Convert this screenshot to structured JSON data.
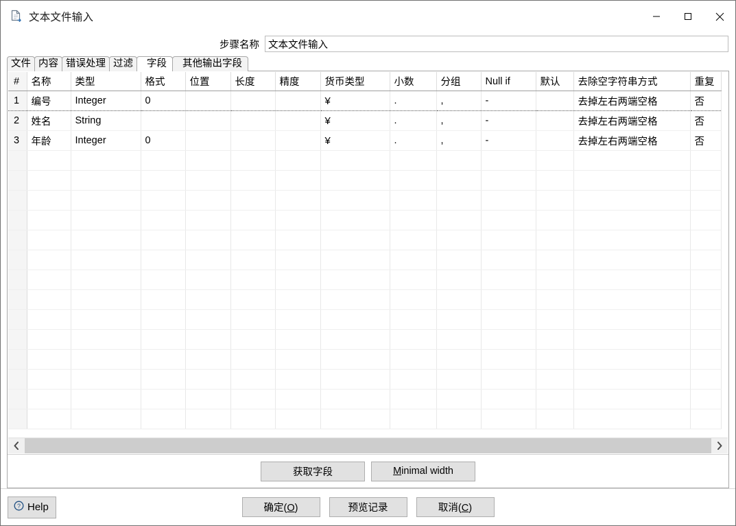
{
  "window": {
    "title": "文本文件输入",
    "icon": "file-input-icon",
    "controls": {
      "minimize": "—",
      "maximize": "□",
      "close": "✕"
    }
  },
  "step": {
    "label": "步骤名称",
    "value": "文本文件输入",
    "placeholder": ""
  },
  "tabs": [
    {
      "label": "文件",
      "selected": false
    },
    {
      "label": "内容",
      "selected": false
    },
    {
      "label": "错误处理",
      "selected": false
    },
    {
      "label": "过滤",
      "selected": false
    },
    {
      "label": "字段",
      "selected": true
    },
    {
      "label": "其他输出字段",
      "selected": false
    }
  ],
  "table": {
    "columns": [
      "#",
      "名称",
      "类型",
      "格式",
      "位置",
      "长度",
      "精度",
      "货币类型",
      "小数",
      "分组",
      "Null if",
      "默认",
      "去除空字符串方式",
      "重复"
    ],
    "rows": [
      {
        "index": "1",
        "name": "编号",
        "type": "Integer",
        "format": "0",
        "position": "",
        "length": "",
        "precision": "",
        "currency": "¥",
        "decimal": ".",
        "group": ",",
        "null_if": "-",
        "default": "",
        "trim": "去掉左右两端空格",
        "repeat": "否"
      },
      {
        "index": "2",
        "name": "姓名",
        "type": "String",
        "format": "",
        "position": "",
        "length": "",
        "precision": "",
        "currency": "¥",
        "decimal": ".",
        "group": ",",
        "null_if": "-",
        "default": "",
        "trim": "去掉左右两端空格",
        "repeat": "否"
      },
      {
        "index": "3",
        "name": "年龄",
        "type": "Integer",
        "format": "0",
        "position": "",
        "length": "",
        "precision": "",
        "currency": "¥",
        "decimal": ".",
        "group": ",",
        "null_if": "-",
        "default": "",
        "trim": "去掉左右两端空格",
        "repeat": "否"
      }
    ],
    "empty_row_count": 14,
    "focused_row": 1
  },
  "scrollbar": {
    "left_arrow": "‹",
    "right_arrow": "›"
  },
  "panel_actions": {
    "get_fields": "获取字段",
    "minimal_width_prefix": "M",
    "minimal_width_rest": "inimal width"
  },
  "bottom": {
    "help": "Help",
    "help_icon": "question-circle-icon",
    "ok_prefix": "确定(",
    "ok_key": "O",
    "ok_suffix": ")",
    "preview": "预览记录",
    "cancel_prefix": "取消(",
    "cancel_key": "C",
    "cancel_suffix": ")"
  },
  "colors": {
    "window_border": "#6f6f6f",
    "panel_border": "#a8a8a8",
    "button_face": "#e1e1e1",
    "index_column": "#f5f5f5",
    "scroll_thumb": "#cdcdcd",
    "accent": "#0078d7"
  }
}
